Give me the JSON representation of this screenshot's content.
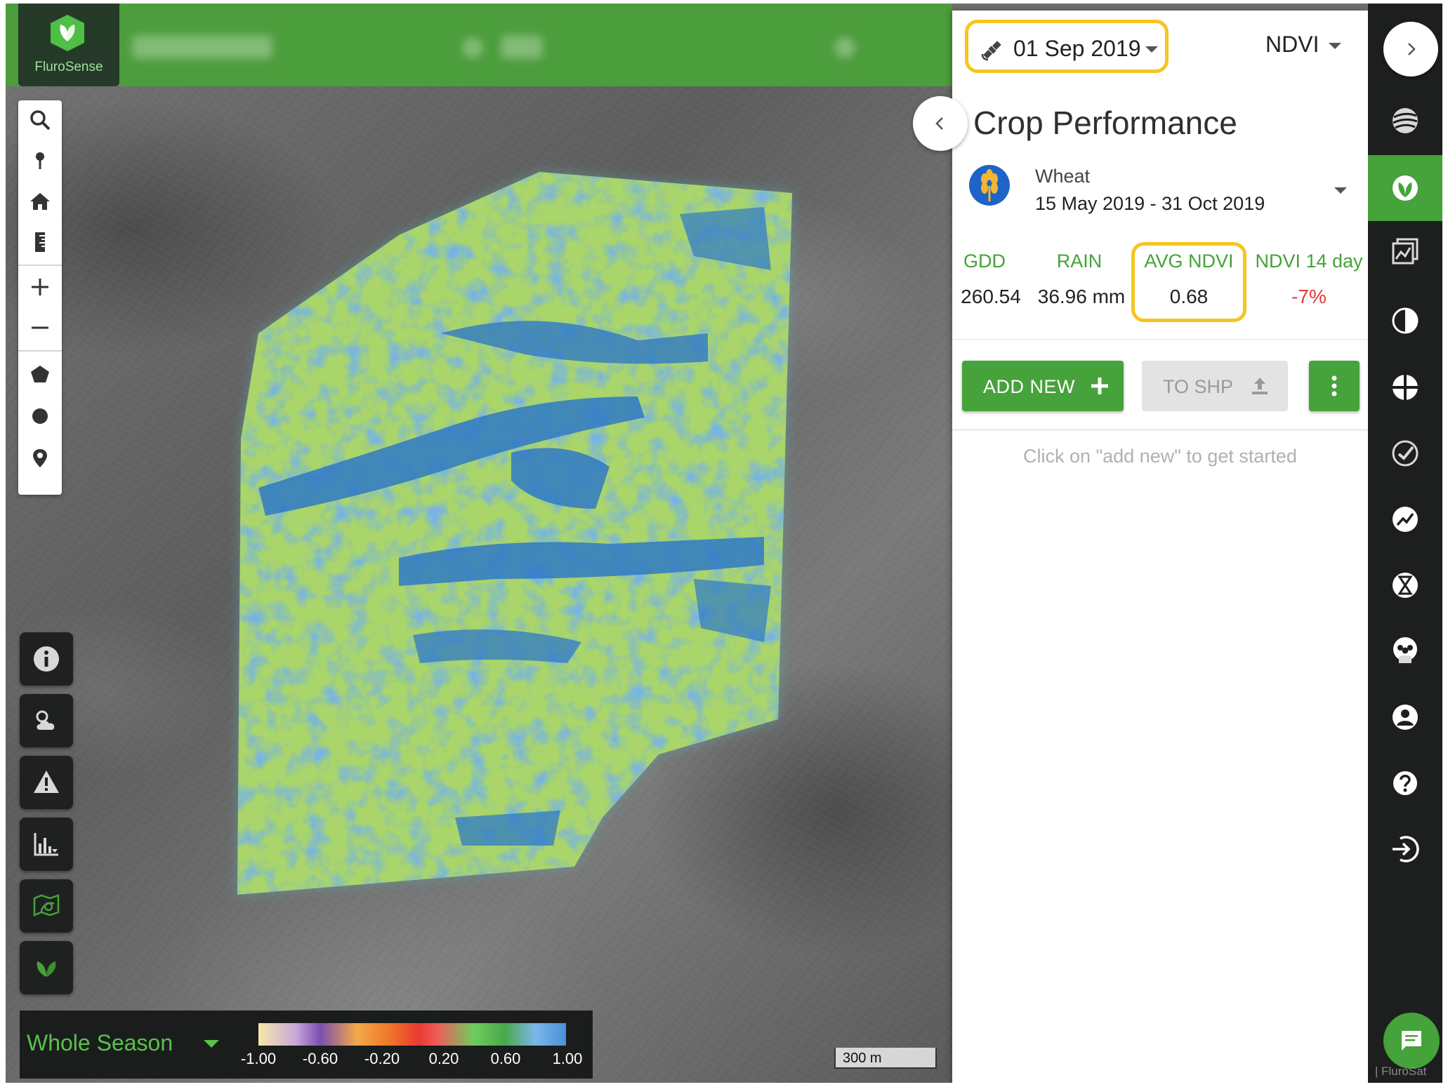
{
  "app": {
    "brand": "FluroSense"
  },
  "header": {},
  "map": {
    "scale_label": "300 m",
    "legend": {
      "period": "Whole Season",
      "ticks": [
        "-1.00",
        "-0.60",
        "-0.20",
        "0.20",
        "0.60",
        "1.00"
      ]
    }
  },
  "panel": {
    "date": "01 Sep 2019",
    "index": "NDVI",
    "title": "Crop Performance",
    "crop": {
      "name": "Wheat",
      "season": "15 May 2019 - 31 Oct 2019"
    },
    "stats": [
      {
        "label": "GDD",
        "value": "260.54"
      },
      {
        "label": "RAIN",
        "value": "36.96 mm"
      },
      {
        "label": "AVG NDVI",
        "value": "0.68"
      },
      {
        "label": "NDVI 14 day",
        "value": "-7%"
      }
    ],
    "add_new_label": "ADD NEW",
    "to_shp_label": "TO SHP",
    "hint": "Click on \"add new\" to get started"
  },
  "colors": {
    "brand_green": "#46a23a",
    "header_green": "#4c9d3c",
    "highlight": "#f7c520",
    "negative": "#e03a3a",
    "dark": "#1d1f1f"
  },
  "icons": {
    "left_tools": [
      "search-icon",
      "pin-icon",
      "home-icon",
      "ruler-icon",
      "zoom-in-icon",
      "zoom-out-icon",
      "polygon-icon",
      "circle-icon",
      "marker-icon"
    ],
    "left_buttons": [
      "info-icon",
      "weather-icon",
      "alert-icon",
      "chart-icon",
      "field-map-icon",
      "leaf-icon"
    ],
    "right_nav": [
      "globe-icon",
      "crop-icon",
      "report-icon",
      "compare-icon",
      "zones-icon",
      "crop-check-icon",
      "trend-icon",
      "hourglass-icon",
      "team-icon",
      "profile-icon",
      "help-icon",
      "logout-icon"
    ]
  },
  "attribution": "| FluroSat"
}
